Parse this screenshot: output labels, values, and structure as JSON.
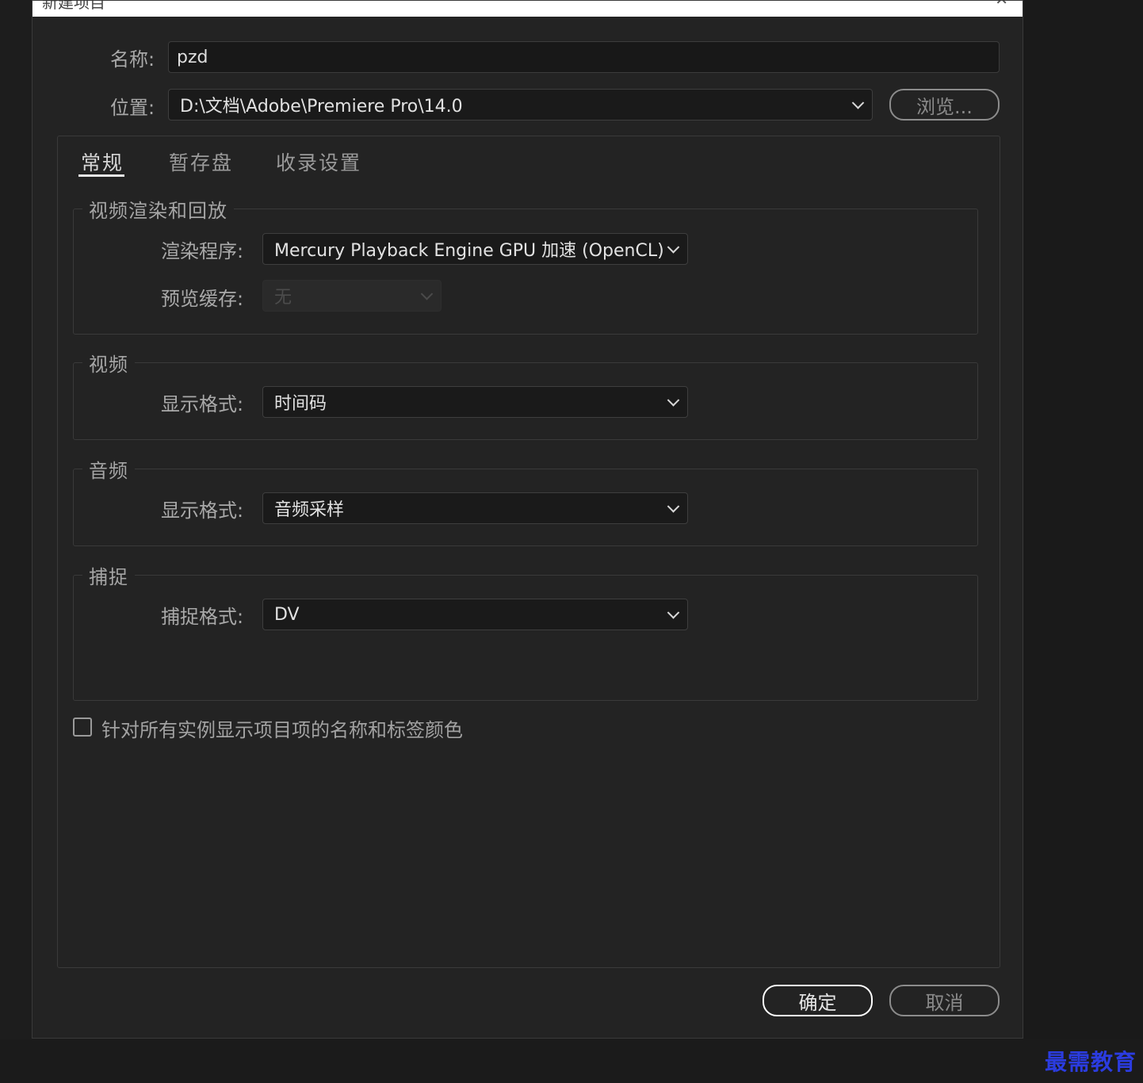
{
  "window": {
    "title": "新建项目",
    "close_glyph": "✕"
  },
  "name_row": {
    "label": "名称:",
    "value": "pzd"
  },
  "location_row": {
    "label": "位置:",
    "value": "D:\\文档\\Adobe\\Premiere Pro\\14.0",
    "browse_label": "浏览..."
  },
  "tabs": [
    {
      "label": "常规",
      "active": true
    },
    {
      "label": "暂存盘",
      "active": false
    },
    {
      "label": "收录设置",
      "active": false
    }
  ],
  "groups": {
    "render": {
      "title": "视频渲染和回放",
      "renderer_label": "渲染程序:",
      "renderer_value": "Mercury Playback Engine GPU 加速 (OpenCL)",
      "preview_cache_label": "预览缓存:",
      "preview_cache_value": "无"
    },
    "video": {
      "title": "视频",
      "format_label": "显示格式:",
      "format_value": "时间码"
    },
    "audio": {
      "title": "音频",
      "format_label": "显示格式:",
      "format_value": "音频采样"
    },
    "capture": {
      "title": "捕捉",
      "format_label": "捕捉格式:",
      "format_value": "DV"
    }
  },
  "checkbox": {
    "label": "针对所有实例显示项目项的名称和标签颜色",
    "checked": false
  },
  "buttons": {
    "ok": "确定",
    "cancel": "取消"
  },
  "watermark": "最需教育"
}
